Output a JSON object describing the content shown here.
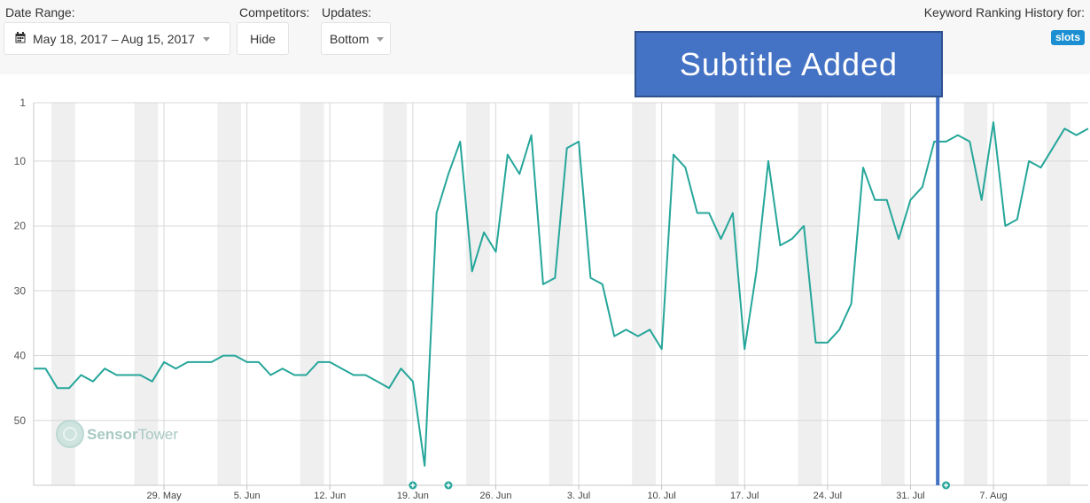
{
  "toolbar": {
    "date_range_label": "Date Range:",
    "date_range_value": "May 18, 2017 – Aug 15, 2017",
    "competitors_label": "Competitors:",
    "competitors_value": "Hide",
    "updates_label": "Updates:",
    "updates_value": "Bottom"
  },
  "keyword": {
    "title": "Keyword Ranking History for:",
    "badge": "slots"
  },
  "annotation": {
    "text": "Subtitle Added",
    "fill_color": "#4472c4",
    "line_color": "#4472c4"
  },
  "watermark": {
    "text_dark": "Sensor",
    "text_light": "Tower"
  },
  "chart_data": {
    "type": "line",
    "title": "",
    "xlabel": "",
    "ylabel": "",
    "y_inverted": true,
    "ylim": [
      1,
      60
    ],
    "yticks": [
      1,
      10,
      20,
      30,
      40,
      50
    ],
    "x_start": "2017-05-18",
    "x_end": "2017-08-15",
    "x_tick_labels": [
      {
        "date": "2017-05-29",
        "label": "29. May"
      },
      {
        "date": "2017-06-05",
        "label": "5. Jun"
      },
      {
        "date": "2017-06-12",
        "label": "12. Jun"
      },
      {
        "date": "2017-06-19",
        "label": "19. Jun"
      },
      {
        "date": "2017-06-26",
        "label": "26. Jun"
      },
      {
        "date": "2017-07-03",
        "label": "3. Jul"
      },
      {
        "date": "2017-07-10",
        "label": "10. Jul"
      },
      {
        "date": "2017-07-17",
        "label": "17. Jul"
      },
      {
        "date": "2017-07-24",
        "label": "24. Jul"
      },
      {
        "date": "2017-07-31",
        "label": "31. Jul"
      },
      {
        "date": "2017-08-07",
        "label": "7. Aug"
      }
    ],
    "series": [
      {
        "color": "#26a69a",
        "points": [
          [
            "2017-05-18",
            42
          ],
          [
            "2017-05-19",
            42
          ],
          [
            "2017-05-20",
            45
          ],
          [
            "2017-05-21",
            45
          ],
          [
            "2017-05-22",
            43
          ],
          [
            "2017-05-23",
            44
          ],
          [
            "2017-05-24",
            42
          ],
          [
            "2017-05-25",
            43
          ],
          [
            "2017-05-26",
            43
          ],
          [
            "2017-05-27",
            43
          ],
          [
            "2017-05-28",
            44
          ],
          [
            "2017-05-29",
            41
          ],
          [
            "2017-05-30",
            42
          ],
          [
            "2017-05-31",
            41
          ],
          [
            "2017-06-01",
            41
          ],
          [
            "2017-06-02",
            41
          ],
          [
            "2017-06-03",
            40
          ],
          [
            "2017-06-04",
            40
          ],
          [
            "2017-06-05",
            41
          ],
          [
            "2017-06-06",
            41
          ],
          [
            "2017-06-07",
            43
          ],
          [
            "2017-06-08",
            42
          ],
          [
            "2017-06-09",
            43
          ],
          [
            "2017-06-10",
            43
          ],
          [
            "2017-06-11",
            41
          ],
          [
            "2017-06-12",
            41
          ],
          [
            "2017-06-13",
            42
          ],
          [
            "2017-06-14",
            43
          ],
          [
            "2017-06-15",
            43
          ],
          [
            "2017-06-16",
            44
          ],
          [
            "2017-06-17",
            45
          ],
          [
            "2017-06-18",
            42
          ],
          [
            "2017-06-19",
            44
          ],
          [
            "2017-06-20",
            57
          ],
          [
            "2017-06-21",
            18
          ],
          [
            "2017-06-22",
            12
          ],
          [
            "2017-06-23",
            7
          ],
          [
            "2017-06-24",
            27
          ],
          [
            "2017-06-25",
            21
          ],
          [
            "2017-06-26",
            24
          ],
          [
            "2017-06-27",
            9
          ],
          [
            "2017-06-28",
            12
          ],
          [
            "2017-06-29",
            6
          ],
          [
            "2017-06-30",
            29
          ],
          [
            "2017-07-01",
            28
          ],
          [
            "2017-07-02",
            8
          ],
          [
            "2017-07-03",
            7
          ],
          [
            "2017-07-04",
            28
          ],
          [
            "2017-07-05",
            29
          ],
          [
            "2017-07-06",
            37
          ],
          [
            "2017-07-07",
            36
          ],
          [
            "2017-07-08",
            37
          ],
          [
            "2017-07-09",
            36
          ],
          [
            "2017-07-10",
            39
          ],
          [
            "2017-07-11",
            9
          ],
          [
            "2017-07-12",
            11
          ],
          [
            "2017-07-13",
            18
          ],
          [
            "2017-07-14",
            18
          ],
          [
            "2017-07-15",
            22
          ],
          [
            "2017-07-16",
            18
          ],
          [
            "2017-07-17",
            39
          ],
          [
            "2017-07-18",
            27
          ],
          [
            "2017-07-19",
            10
          ],
          [
            "2017-07-20",
            23
          ],
          [
            "2017-07-21",
            22
          ],
          [
            "2017-07-22",
            20
          ],
          [
            "2017-07-23",
            38
          ],
          [
            "2017-07-24",
            38
          ],
          [
            "2017-07-25",
            36
          ],
          [
            "2017-07-26",
            32
          ],
          [
            "2017-07-27",
            11
          ],
          [
            "2017-07-28",
            16
          ],
          [
            "2017-07-29",
            16
          ],
          [
            "2017-07-30",
            22
          ],
          [
            "2017-07-31",
            16
          ],
          [
            "2017-08-01",
            14
          ],
          [
            "2017-08-02",
            7
          ],
          [
            "2017-08-03",
            7
          ],
          [
            "2017-08-04",
            6
          ],
          [
            "2017-08-05",
            7
          ],
          [
            "2017-08-06",
            16
          ],
          [
            "2017-08-07",
            4
          ],
          [
            "2017-08-08",
            20
          ],
          [
            "2017-08-09",
            19
          ],
          [
            "2017-08-10",
            10
          ],
          [
            "2017-08-11",
            11
          ],
          [
            "2017-08-12",
            8
          ],
          [
            "2017-08-13",
            5
          ],
          [
            "2017-08-14",
            6
          ],
          [
            "2017-08-15",
            5
          ]
        ]
      }
    ],
    "update_markers": [
      "2017-06-19",
      "2017-06-22",
      "2017-08-03"
    ],
    "annotation_date": "2017-08-02",
    "grid": true
  }
}
